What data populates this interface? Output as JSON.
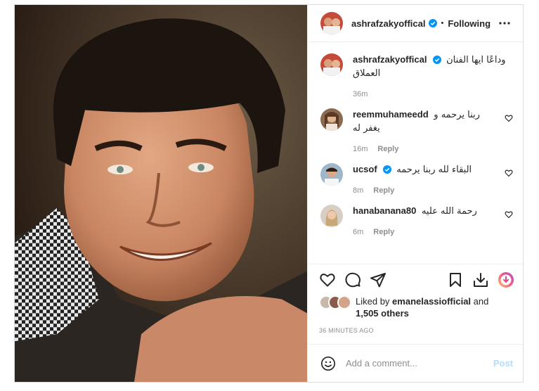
{
  "post": {
    "image_alt": "Portrait photo of the late artist",
    "author": "ashrafzakyoffical",
    "follow_label": "Following",
    "dot": "•",
    "caption": {
      "username": "ashrafzakyoffical",
      "text": "وداعًا ايها الفنان العملاق",
      "time": "36m"
    },
    "comments": [
      {
        "username": "reemmuhameedd",
        "text": "ربنا يرحمه و يغفر له",
        "time": "16m",
        "reply": "Reply",
        "verified": false
      },
      {
        "username": "ucsof",
        "text": "البقاء لله ربنا يرحمه",
        "time": "8m",
        "reply": "Reply",
        "verified": true
      },
      {
        "username": "hanabanana80",
        "text": "رحمة الله عليه",
        "time": "6m",
        "reply": "Reply",
        "verified": false
      }
    ],
    "likes": {
      "prefix": "Liked by",
      "user": "emanelassiofficial",
      "and": "and",
      "others": "1,505 others"
    },
    "timestamp": "36 MINUTES AGO",
    "add_comment": {
      "placeholder": "Add a comment...",
      "post_label": "Post"
    }
  },
  "colors": {
    "verified": "#0095f6",
    "post_disabled": "#b3dbff",
    "muted": "#8e8e8e"
  }
}
